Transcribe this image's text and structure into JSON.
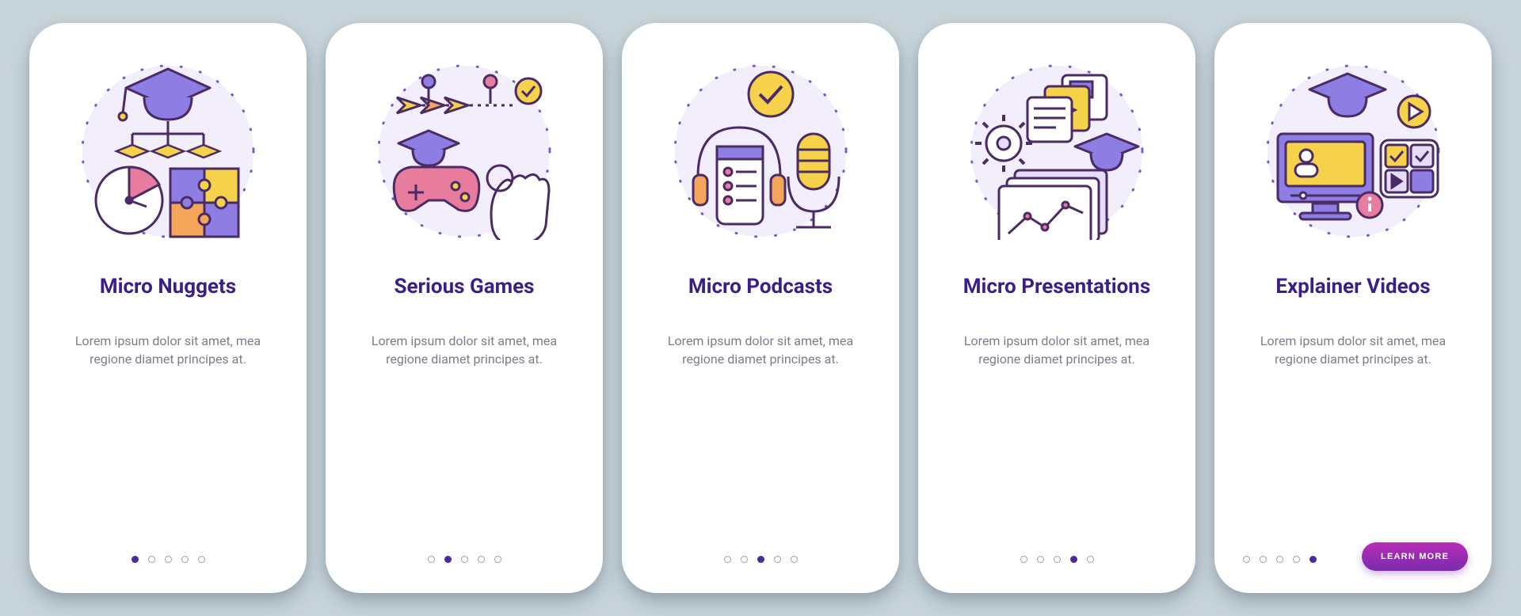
{
  "colors": {
    "purple": "#6F5BCF",
    "dark_purple": "#3B1E87",
    "lavender": "#E5DDF7",
    "yellow": "#F6D24B",
    "orange": "#F5A55A",
    "pink": "#E77C9F",
    "stroke": "#4A2B66"
  },
  "screens": [
    {
      "id": "micro-nuggets",
      "title": "Micro Nuggets",
      "desc": "Lorem ipsum dolor sit amet, mea regione diamet principes at.",
      "active_index": 0,
      "show_cta": false
    },
    {
      "id": "serious-games",
      "title": "Serious Games",
      "desc": "Lorem ipsum dolor sit amet, mea regione diamet principes at.",
      "active_index": 1,
      "show_cta": false
    },
    {
      "id": "micro-podcasts",
      "title": "Micro Podcasts",
      "desc": "Lorem ipsum dolor sit amet, mea regione diamet principes at.",
      "active_index": 2,
      "show_cta": false
    },
    {
      "id": "micro-presentations",
      "title": "Micro Presentations",
      "desc": "Lorem ipsum dolor sit amet, mea regione diamet principes at.",
      "active_index": 3,
      "show_cta": false
    },
    {
      "id": "explainer-videos",
      "title": "Explainer Videos",
      "desc": "Lorem ipsum dolor sit amet, mea regione diamet principes at.",
      "active_index": 4,
      "show_cta": true
    }
  ],
  "cta_label": "LEARN MORE",
  "total_dots": 5
}
